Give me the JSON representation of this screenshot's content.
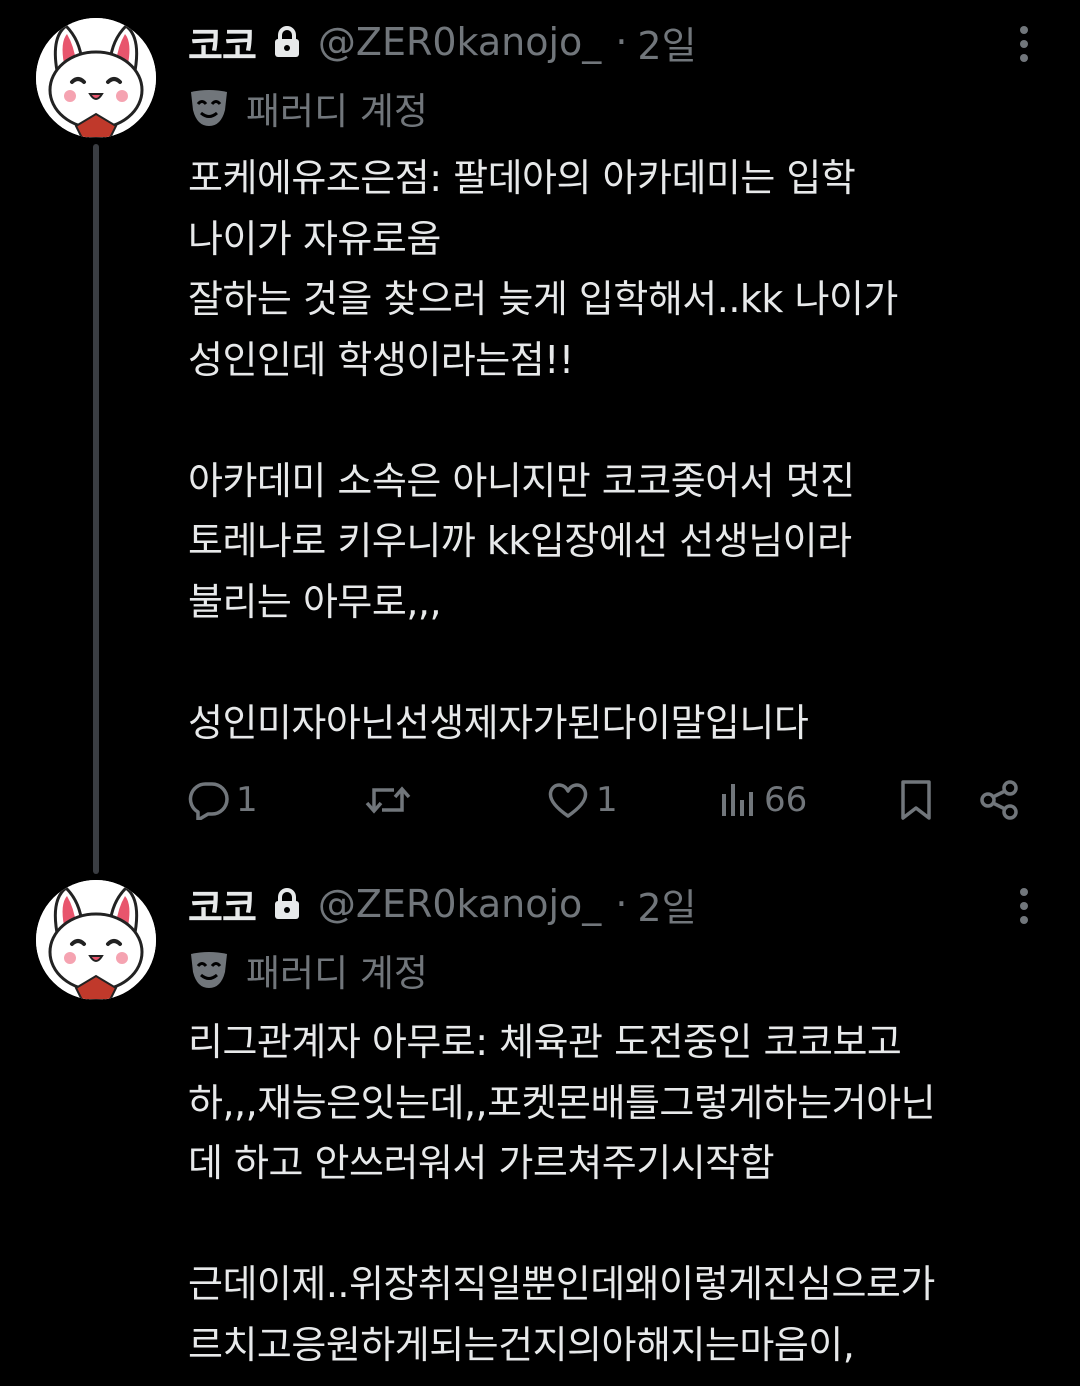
{
  "tweets": [
    {
      "display_name": "코코",
      "handle": "@ZER0kanojo_",
      "separator": "·",
      "time": "2일",
      "account_label": "패러디 계정",
      "body": "포케에유조은점: 팔데아의 아카데미는 입학\n나이가 자유로움\n잘하는 것을 찾으러 늦게 입학해서..kk 나이가\n성인인데 학생이라는점!!\n\n아카데미 소속은 아니지만 코코좆어서 멋진\n토레나로 키우니까 kk입장에선 선생님이라\n불리는 아무로,,,\n\n성인미자아닌선생제자가된다이말입니다",
      "reply_count": "1",
      "like_count": "1",
      "view_count": "66"
    },
    {
      "display_name": "코코",
      "handle": "@ZER0kanojo_",
      "separator": "·",
      "time": "2일",
      "account_label": "패러디 계정",
      "body": "리그관계자 아무로: 체육관 도전중인 코코보고\n하,,,재능은잇는데,,포켓몬배틀그렇게하는거아닌\n데 하고 안쓰러워서 가르쳐주기시작함\n\n근데이제..위장취직일뿐인데왜이렇게진심으로가\n르치고응원하게되는건지의아해지는마음이,"
    }
  ],
  "icons": {
    "lock": "lock-icon",
    "more": "more-vertical-icon",
    "parody": "mask-icon",
    "reply": "reply-icon",
    "retweet": "retweet-icon",
    "like": "heart-icon",
    "views": "views-icon",
    "bookmark": "bookmark-icon",
    "share": "share-icon"
  },
  "colors": {
    "background": "#000000",
    "text": "#e7e9ea",
    "muted": "#71767b",
    "thread_line": "#3a3d42"
  }
}
